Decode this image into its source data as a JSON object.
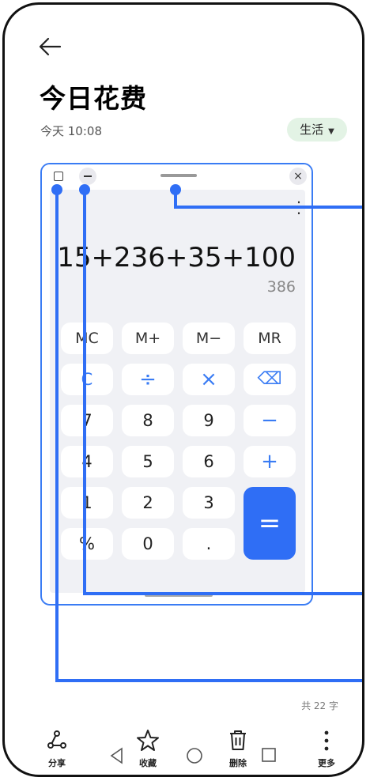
{
  "header": {
    "title": "今日花费",
    "time": "今天 10:08",
    "category": "生活",
    "category_caret": "▼"
  },
  "floating_window": {
    "close_glyph": "×",
    "more_glyph": "⋮",
    "expression": "15+236+35+100",
    "result": "386",
    "keys": {
      "mc": "MC",
      "m_plus": "M+",
      "m_minus": "M−",
      "mr": "MR",
      "c": "C",
      "divide": "÷",
      "multiply": "×",
      "backspace": "⌫",
      "seven": "7",
      "eight": "8",
      "nine": "9",
      "minus": "−",
      "four": "4",
      "five": "5",
      "six": "6",
      "plus": "+",
      "one": "1",
      "two": "2",
      "three": "3",
      "equals": "=",
      "percent": "%",
      "zero": "0",
      "dot": "."
    }
  },
  "footer": {
    "char_count": "共 22 字",
    "share": "分享",
    "favorite": "收藏",
    "delete": "删除",
    "more": "更多"
  },
  "colors": {
    "accent": "#2f6ef5",
    "category_bg": "#e3f3e5"
  },
  "icons": [
    "back-arrow-icon",
    "share-icon",
    "star-icon",
    "trash-icon",
    "more-vertical-icon",
    "nav-back-icon",
    "nav-home-icon",
    "nav-recents-icon"
  ]
}
